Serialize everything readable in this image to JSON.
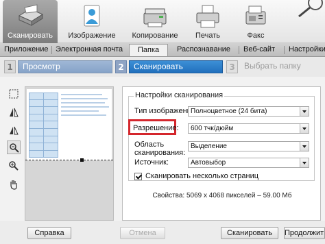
{
  "toolbar": {
    "items": [
      {
        "label": "Сканировать",
        "icon": "scanner-icon"
      },
      {
        "label": "Изображение",
        "icon": "image-user-icon"
      },
      {
        "label": "Копирование",
        "icon": "copier-icon"
      },
      {
        "label": "Печать",
        "icon": "printer-icon"
      },
      {
        "label": "Факс",
        "icon": "fax-icon"
      }
    ],
    "active_index": 0
  },
  "nav": {
    "items": [
      "Приложение",
      "Электронная почта",
      "Папка",
      "Распознавание",
      "Веб-сайт",
      "Настройки"
    ],
    "active": "Папка"
  },
  "steps": [
    {
      "num": "1",
      "label": "Просмотр"
    },
    {
      "num": "2",
      "label": "Сканировать"
    },
    {
      "num": "3",
      "label": "Выбрать папку"
    }
  ],
  "settings": {
    "group_title": "Настройки сканирования",
    "image_type_label": "Тип изображения:",
    "image_type_value": "Полноцветное (24 бита)",
    "resolution_label": "Разрешение:",
    "resolution_value": "600 тчк/дюйм",
    "area_label_line1": "Область",
    "area_label_line2": "сканирования:",
    "area_value": "Выделение",
    "source_label": "Источник:",
    "source_value": "Автовыбор",
    "multi_page_label": "Сканировать несколько страниц",
    "multi_page_checked": true,
    "properties": "Свойства: 5069 x 4068 пикселей – 59.00 Мб"
  },
  "buttons": {
    "help": "Справка",
    "cancel": "Отмена",
    "scan": "Сканировать",
    "continue": "Продолжить"
  },
  "colors": {
    "highlight_box": "#d4262c",
    "active_step": "#2170bd"
  }
}
